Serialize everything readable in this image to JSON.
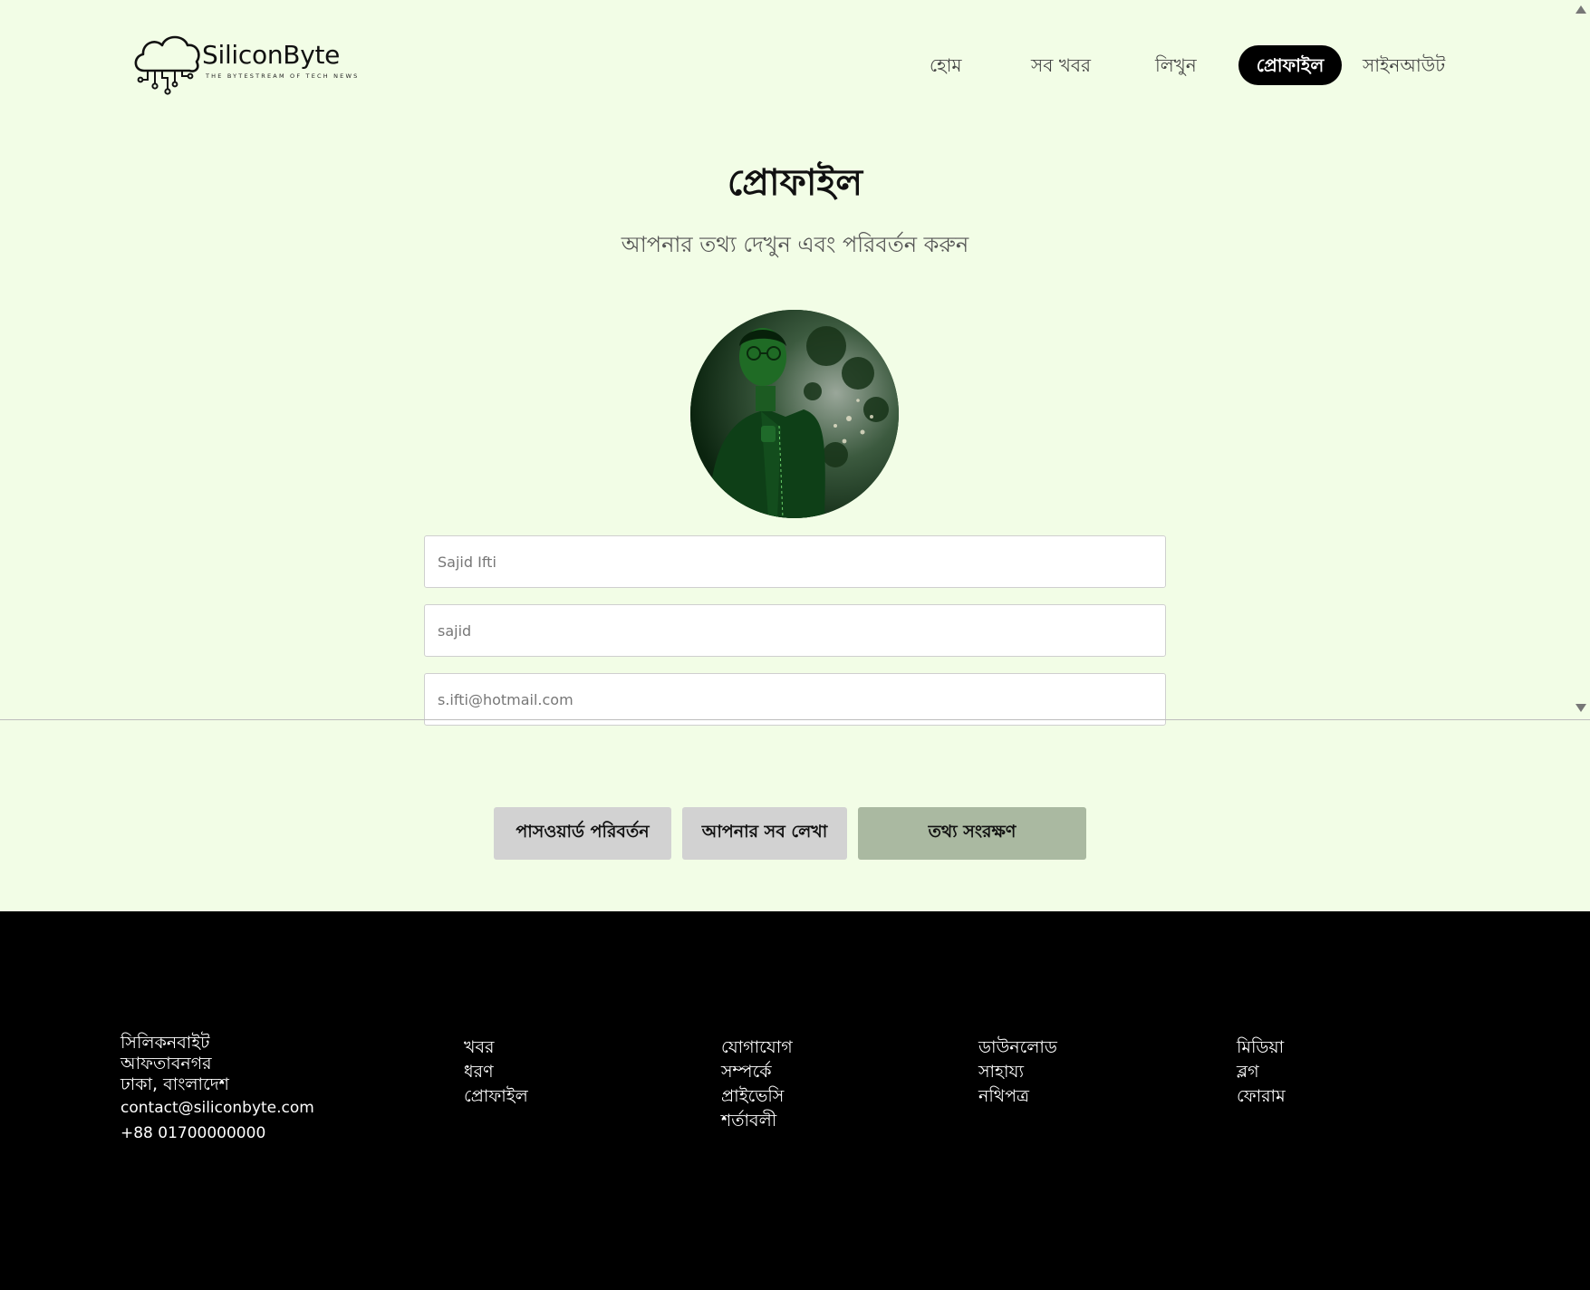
{
  "brand": {
    "name": "SiliconByte",
    "tagline": "THE BYTESTREAM OF TECH NEWS"
  },
  "nav": {
    "home": "হোম",
    "all_news": "সব খবর",
    "write": "লিখুন",
    "profile": "প্রোফাইল",
    "signout": "সাইনআউট"
  },
  "page": {
    "title": "প্রোফাইল",
    "subtitle": "আপনার তথ্য দেখুন এবং পরিবর্তন করুন"
  },
  "form": {
    "fullname_placeholder": "Sajid Ifti",
    "username_placeholder": "sajid",
    "email_placeholder": "s.ifti@hotmail.com"
  },
  "buttons": {
    "change_password": "পাসওয়ার্ড পরিবর্তন",
    "my_posts": "আপনার সব লেখা",
    "save_info": "তথ্য সংরক্ষণ"
  },
  "footer": {
    "address": {
      "company": "সিলিকনবাইট",
      "line1": "আফতাবনগর",
      "line2": "ঢাকা, বাংলাদেশ",
      "email": "contact@siliconbyte.com",
      "phone": "+88 01700000000"
    },
    "col1": [
      "খবর",
      "ধরণ",
      "প্রোফাইল"
    ],
    "col2": [
      "যোগাযোগ",
      "সম্পর্কে",
      "প্রাইভেসি",
      "শর্তাবলী"
    ],
    "col3": [
      "ডাউনলোড",
      "সাহায্য",
      "নথিপত্র"
    ],
    "col4": [
      "মিডিয়া",
      "ব্লগ",
      "ফোরাম"
    ]
  },
  "colors": {
    "page_bg": "#f2fde6",
    "nav_active_bg": "#000000",
    "save_button_bg": "#aab9a1",
    "secondary_button_bg": "#d2d2d2",
    "footer_bg": "#000000"
  },
  "icons": {
    "logo": "cloud-circuit-logo",
    "avatar": "profile-photo"
  }
}
